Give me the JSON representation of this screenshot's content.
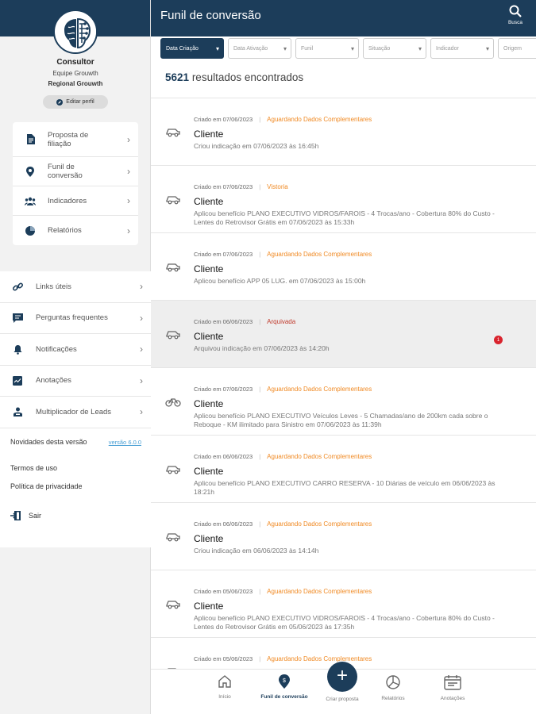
{
  "sidebar": {
    "profile": {
      "name": "Consultor",
      "team": "Equipe Grouwth",
      "region": "Regional Grouwth",
      "edit_label": "Editar perfil"
    },
    "card_items": [
      {
        "label": "Proposta de filiação",
        "icon": "document-icon"
      },
      {
        "label": "Funil de conversão",
        "icon": "location-pin-icon"
      },
      {
        "label": "Indicadores",
        "icon": "people-icon"
      },
      {
        "label": "Relatórios",
        "icon": "pie-chart-icon"
      }
    ],
    "list_items": [
      {
        "label": "Links úteis",
        "icon": "link-icon"
      },
      {
        "label": "Perguntas frequentes",
        "icon": "chat-icon"
      },
      {
        "label": "Notificações",
        "icon": "bell-icon"
      },
      {
        "label": "Anotações",
        "icon": "notes-icon"
      },
      {
        "label": "Multiplicador de Leads",
        "icon": "person-card-icon"
      }
    ],
    "news_label": "Novidades desta versão",
    "version_label": "versão 6.0.0",
    "terms_label": "Termos de uso",
    "privacy_label": "Política de privacidade",
    "logout_label": "Sair"
  },
  "header": {
    "title": "Funil de conversão",
    "search_label": "Busca"
  },
  "filters": [
    {
      "label": "Data Criação",
      "active": true
    },
    {
      "label": "Data Ativação",
      "active": false
    },
    {
      "label": "Funil",
      "active": false
    },
    {
      "label": "Situação",
      "active": false
    },
    {
      "label": "Indicador",
      "active": false
    },
    {
      "label": "Origem",
      "active": false
    }
  ],
  "results": {
    "count": "5621",
    "label": "resultados encontrados"
  },
  "items": [
    {
      "date": "Criado em 07/06/2023",
      "status": "Aguardando Dados Complementares",
      "status_color": "#f08a24",
      "title": "Cliente",
      "desc": "Criou indicação em 07/06/2023 às 16:45h",
      "archived": false,
      "badge": ""
    },
    {
      "date": "Criado em 07/06/2023",
      "status": "Vistoria",
      "status_color": "#f08a24",
      "title": "Cliente",
      "desc": "Aplicou benefício PLANO EXECUTIVO VIDROS/FAROIS - 4 Trocas/ano - Cobertura 80% do Custo - Lentes do Retrovisor Grátis em 07/06/2023 às 15:33h",
      "archived": false,
      "badge": ""
    },
    {
      "date": "Criado em 07/06/2023",
      "status": "Aguardando Dados Complementares",
      "status_color": "#f08a24",
      "title": "Cliente",
      "desc": "Aplicou benefício APP 05 LUG. em 07/06/2023 às 15:00h",
      "archived": false,
      "badge": ""
    },
    {
      "date": "Criado em 06/06/2023",
      "status": "Arquivada",
      "status_color": "#c0392b",
      "title": "Cliente",
      "desc": "Arquivou indicação em 07/06/2023 às 14:20h",
      "archived": true,
      "badge": "1"
    },
    {
      "date": "Criado em 07/06/2023",
      "status": "Aguardando Dados Complementares",
      "status_color": "#f08a24",
      "title": "Cliente",
      "desc": "Aplicou benefício PLANO EXECUTIVO Veículos Leves - 5 Chamadas/ano de 200km cada sobre o Reboque - KM ilimitado para Sinistro em 07/06/2023 às 11:39h",
      "archived": false,
      "badge": ""
    },
    {
      "date": "Criado em 06/06/2023",
      "status": "Aguardando Dados Complementares",
      "status_color": "#f08a24",
      "title": "Cliente",
      "desc": "Aplicou benefício PLANO EXECUTIVO CARRO RESERVA - 10 Diárias de veículo em 06/06/2023 às 18:21h",
      "archived": false,
      "badge": ""
    },
    {
      "date": "Criado em 06/06/2023",
      "status": "Aguardando Dados Complementares",
      "status_color": "#f08a24",
      "title": "Cliente",
      "desc": "Criou indicação em 06/06/2023 às 14:14h",
      "archived": false,
      "badge": ""
    },
    {
      "date": "Criado em 05/06/2023",
      "status": "Aguardando Dados Complementares",
      "status_color": "#f08a24",
      "title": "Cliente",
      "desc": "Aplicou benefício PLANO EXECUTIVO VIDROS/FAROIS - 4 Trocas/ano - Cobertura 80% do Custo - Lentes do Retrovisor Grátis em 05/06/2023 às 17:35h",
      "archived": false,
      "badge": ""
    },
    {
      "date": "Criado em 05/06/2023",
      "status": "Aguardando Dados Complementares",
      "status_color": "#f08a24",
      "title": "",
      "desc": "",
      "archived": false,
      "badge": ""
    }
  ],
  "bottom_nav": {
    "home": "Início",
    "funnel": "Funil de conversão",
    "create": "Criar proposta",
    "reports": "Relatórios",
    "notes": "Anotações"
  },
  "colors": {
    "primary": "#1c3d5a",
    "status_pending": "#f08a24",
    "status_archived": "#c0392b",
    "badge": "#d9232d"
  }
}
